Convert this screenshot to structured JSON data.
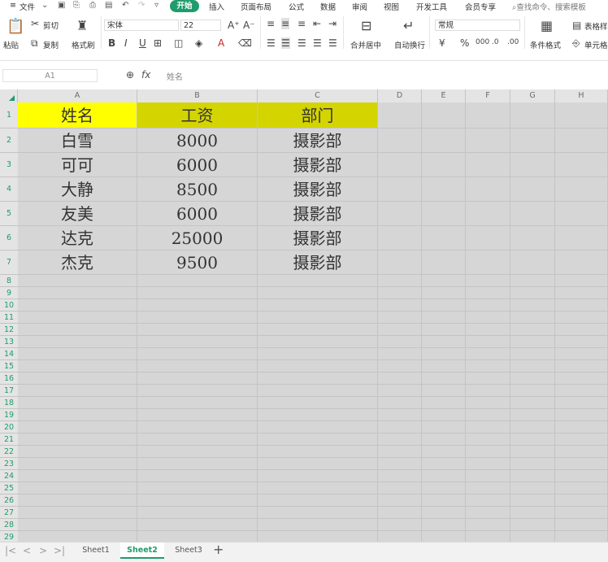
{
  "menubar": {
    "file": "文件",
    "tabs": [
      "开始",
      "插入",
      "页面布局",
      "公式",
      "数据",
      "审阅",
      "视图",
      "开发工具",
      "会员专享"
    ],
    "search_placeholder": "查找命令、搜索模板"
  },
  "ribbon": {
    "paste": "粘贴",
    "cut": "剪切",
    "copy": "复制",
    "format_painter": "格式刷",
    "font_name": "宋体",
    "font_size": "22",
    "merge_center": "合并居中",
    "wrap_text": "自动换行",
    "number_format": "常规",
    "conditional_format": "条件格式",
    "table_style": "表格样",
    "cell_style": "单元格"
  },
  "formula": {
    "name_box": "A1",
    "fx_label": "fx",
    "value": "姓名"
  },
  "grid": {
    "columns": [
      "A",
      "B",
      "C",
      "D",
      "E",
      "F",
      "G",
      "H"
    ],
    "rows": [
      "1",
      "2",
      "3",
      "4",
      "5",
      "6",
      "7",
      "8",
      "9",
      "10",
      "11",
      "12",
      "13",
      "14",
      "15",
      "16",
      "17",
      "18",
      "19",
      "20",
      "21",
      "22",
      "23",
      "24",
      "25",
      "26",
      "27",
      "28",
      "29"
    ],
    "header_row": [
      "姓名",
      "工资",
      "部门"
    ],
    "data": [
      [
        "白雪",
        "8000",
        "摄影部"
      ],
      [
        "可可",
        "6000",
        "摄影部"
      ],
      [
        "大静",
        "8500",
        "摄影部"
      ],
      [
        "友美",
        "6000",
        "摄影部"
      ],
      [
        "达克",
        "25000",
        "摄影部"
      ],
      [
        "杰克",
        "9500",
        "摄影部"
      ]
    ],
    "colors": {
      "name_header_bg": "#ffff00",
      "other_header_bg": "#d4d400",
      "accent": "#1f9c6b"
    }
  },
  "sheets": {
    "tabs": [
      "Sheet1",
      "Sheet2",
      "Sheet3"
    ],
    "active": "Sheet2"
  }
}
